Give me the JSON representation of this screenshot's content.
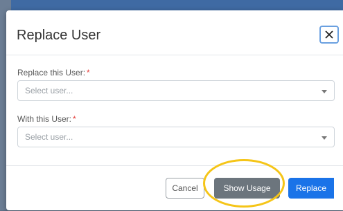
{
  "modal": {
    "title": "Replace User",
    "close_icon": "close-icon"
  },
  "fields": [
    {
      "label": "Replace this User:",
      "required_mark": "*",
      "placeholder": "Select user..."
    },
    {
      "label": "With this User:",
      "required_mark": "*",
      "placeholder": "Select user..."
    }
  ],
  "footer": {
    "cancel_label": "Cancel",
    "show_usage_label": "Show Usage",
    "replace_label": "Replace"
  },
  "colors": {
    "primary": "#1a73e8",
    "secondary": "#6c757d",
    "highlight": "#f5c518",
    "required": "#e53935"
  }
}
